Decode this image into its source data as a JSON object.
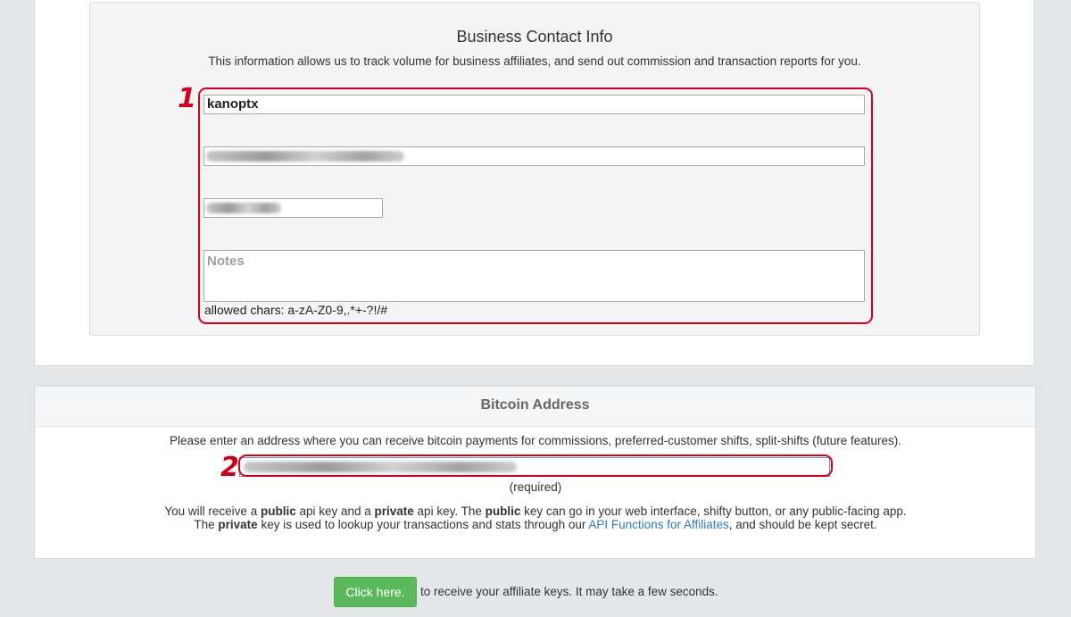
{
  "business": {
    "title": "Business Contact Info",
    "description": "This information allows us to track volume for business affiliates, and send out commission and transaction reports for you.",
    "name_value": "kanoptx",
    "notes_placeholder": "Notes",
    "allowed_chars": "allowed chars: a-zA-Z0-9,.*+-?!/#",
    "marker": "1"
  },
  "bitcoin": {
    "title": "Bitcoin Address",
    "description": "Please enter an address where you can receive bitcoin payments for commissions, preferred-customer shifts, split-shifts (future features).",
    "required": "(required)",
    "marker": "2",
    "keys_line1": {
      "p1": "You will receive a ",
      "public": "public",
      "p2": " api key and a ",
      "private": "private",
      "p3": " api key. The ",
      "public2": "public",
      "p4": " key can go in your web interface, shifty button, or any public-facing app."
    },
    "keys_line2": {
      "p1": "The ",
      "private": "private",
      "p2": " key is used to lookup your transactions and stats through our ",
      "link": "API Functions for Affiliates",
      "p3": ", and should be kept secret."
    }
  },
  "action": {
    "button_label": "Click here.",
    "after_text": "to receive your affiliate keys. It may take a few seconds."
  },
  "colors": {
    "highlight": "#d0021b",
    "button": "#5cb85c",
    "link": "#337ab7"
  }
}
